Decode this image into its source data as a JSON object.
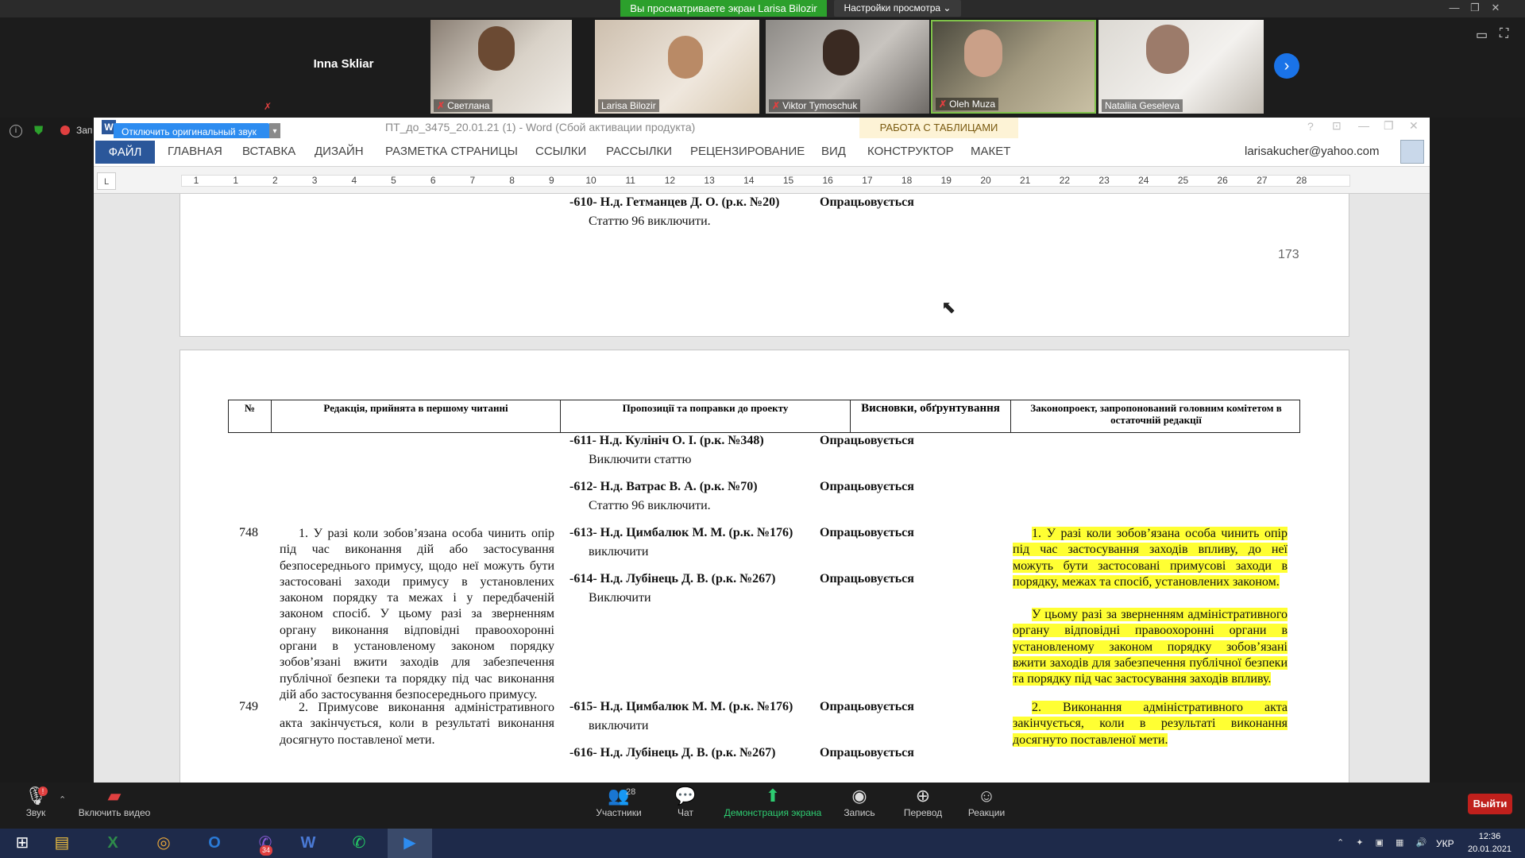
{
  "zoom": {
    "share_banner": "Вы просматриваете экран Larisa Bilozir",
    "view_options": "Настройки просмотра",
    "participants": [
      {
        "name": "Inna Skliar",
        "muted": true
      },
      {
        "name": "Светлана",
        "muted": true
      },
      {
        "name": "Larisa Bilozir",
        "muted": false
      },
      {
        "name": "Viktor Tymoschuk",
        "muted": true
      },
      {
        "name": "Oleh Muza",
        "muted": true
      },
      {
        "name": "Nataliia Geseleva",
        "muted": false
      }
    ],
    "tooltip": "Отключить оригинальный звук",
    "side_label": "Зап",
    "bottom": {
      "audio": "Звук",
      "audio_badge": "!",
      "video": "Включить видео",
      "participants": "Участники",
      "participants_count": "28",
      "chat": "Чат",
      "share": "Демонстрация экрана",
      "record": "Запись",
      "translate": "Перевод",
      "reactions": "Реакции",
      "leave": "Выйти"
    }
  },
  "word": {
    "title": "ПТ_до_3475_20.01.21 (1) - Word (Сбой активации продукта)",
    "context_tab": "РАБОТА С ТАБЛИЦАМИ",
    "tabs": [
      "ФАЙЛ",
      "ГЛАВНАЯ",
      "ВСТАВКА",
      "ДИЗАЙН",
      "РАЗМЕТКА СТРАНИЦЫ",
      "ССЫЛКИ",
      "РАССЫЛКИ",
      "РЕЦЕНЗИРОВАНИЕ",
      "ВИД",
      "КОНСТРУКТОР",
      "МАКЕТ"
    ],
    "account": "larisakucher@yahoo.com",
    "ruler": [
      "1",
      "1",
      "2",
      "3",
      "4",
      "5",
      "6",
      "7",
      "8",
      "9",
      "10",
      "11",
      "12",
      "13",
      "14",
      "15",
      "16",
      "17",
      "18",
      "19",
      "20",
      "21",
      "22",
      "23",
      "24",
      "25",
      "26",
      "27",
      "28"
    ],
    "page1": {
      "item610": "-610- Н.д. Гетманцев Д. О. (р.к. №20)",
      "item610_text": "Статтю 96 виключити.",
      "item610_status": "Опрацьовується",
      "page_number": "173"
    },
    "table_headers": [
      "№",
      "Редакція, прийнята в першому читанні",
      "Пропозиції та поправки до проекту",
      "Висновки, обґрунтування",
      "Законопроект, запропонований головним комітетом в остаточній редакції"
    ],
    "rows": {
      "p611": "-611- Н.д. Кулініч О. І. (р.к. №348)",
      "p611t": "Виключити статтю",
      "p612": "-612- Н.д. Ватрас В. А. (р.к. №70)",
      "p612t": "Статтю 96 виключити.",
      "n748": "748",
      "r748": "1. У разі коли зобов’язана особа чинить опір під час виконання дій або застосування безпосереднього примусу, щодо неї можуть бути застосовані заходи примусу в установлених законом порядку та межах і у передбаченій законом спосіб. У цьому разі за зверненням органу виконання відповідні правоохоронні органи в установленому законом порядку зобов’язані вжити заходів для забезпечення публічної безпеки та порядку під час виконання дій або застосування безпосереднього примусу.",
      "p613": "-613- Н.д. Цимбалюк М. М. (р.к. №176)",
      "p613t": "виключити",
      "p614": "-614- Н.д. Лубінець Д. В. (р.к. №267)",
      "p614t": "Виключити",
      "f748a": "1. У разі коли зобов’язана особа чинить опір під час застосування заходів впливу, до неї можуть бути застосовані примусові заходи в порядку, межах та спосіб, установлених законом.",
      "f748b": "У цьому разі за зверненням адміністративного органу відповідні правоохоронні органи в установленому законом порядку зобов’язані вжити заходів для забезпечення публічної безпеки та порядку під час застосування заходів впливу.",
      "n749": "749",
      "r749": "2. Примусове виконання адміністративного акта закінчується, коли в результаті виконання досягнуто поставленої мети.",
      "p615": "-615- Н.д. Цимбалюк М. М. (р.к. №176)",
      "p615t": "виключити",
      "p616": "-616- Н.д. Лубінець Д. В. (р.к. №267)",
      "f749": "2. Виконання адміністративного акта закінчується, коли в результаті виконання досягнуто поставленої мети.",
      "status": "Опрацьовується"
    }
  },
  "taskbar": {
    "lang": "УКР",
    "time": "12:36",
    "date": "20.01.2021",
    "viber_badge": "34"
  }
}
